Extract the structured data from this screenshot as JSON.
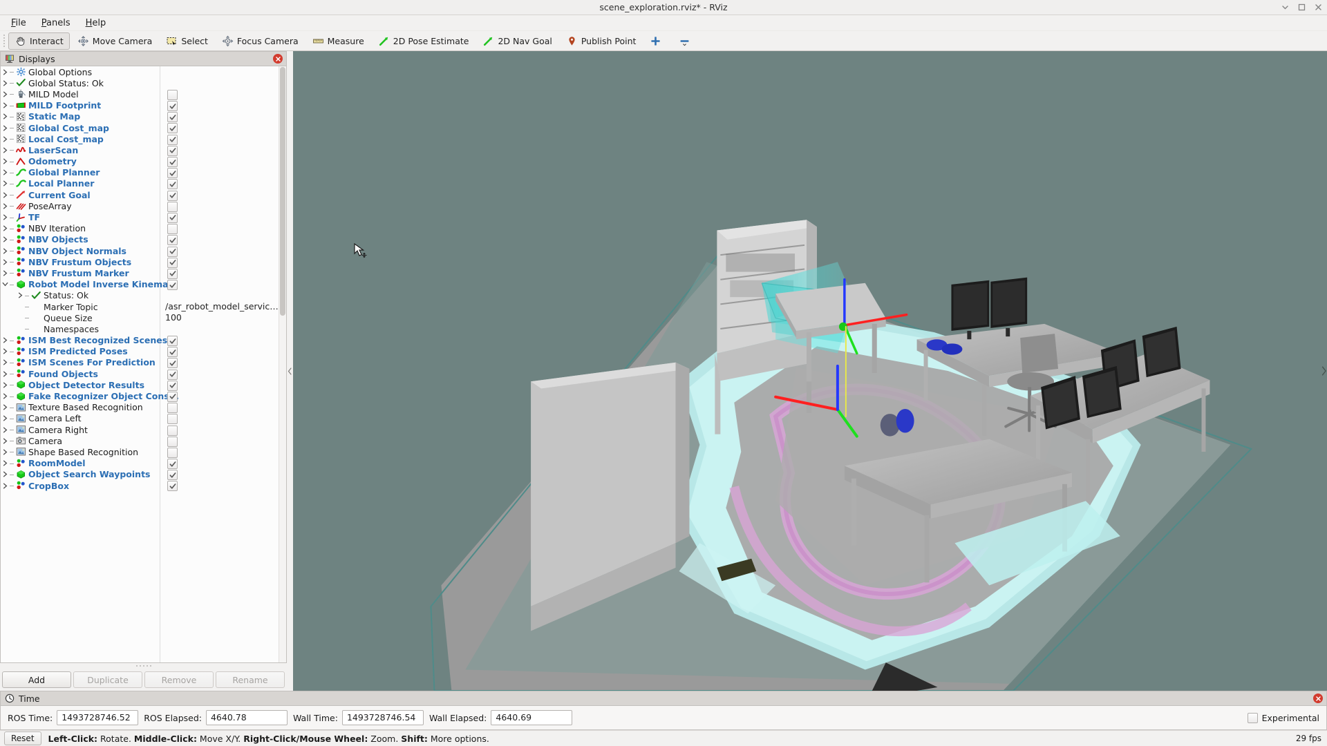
{
  "window": {
    "title": "scene_exploration.rviz* - RViz",
    "buttons": {
      "minimize": "minimize-button",
      "maximize": "maximize-button",
      "close": "close-button"
    }
  },
  "menubar": {
    "items": [
      {
        "label": "File",
        "mnemonic": "F"
      },
      {
        "label": "Panels",
        "mnemonic": "P"
      },
      {
        "label": "Help",
        "mnemonic": "H"
      }
    ]
  },
  "toolbar": {
    "items": [
      {
        "label": "Interact",
        "icon": "hand-icon",
        "active": true
      },
      {
        "label": "Move Camera",
        "icon": "move-camera-icon",
        "active": false
      },
      {
        "label": "Select",
        "icon": "select-rect-icon",
        "active": false
      },
      {
        "label": "Focus Camera",
        "icon": "focus-camera-icon",
        "active": false
      },
      {
        "label": "Measure",
        "icon": "ruler-icon",
        "active": false
      },
      {
        "label": "2D Pose Estimate",
        "icon": "green-arrow-icon",
        "active": false
      },
      {
        "label": "2D Nav Goal",
        "icon": "green-arrow-icon",
        "active": false
      },
      {
        "label": "Publish Point",
        "icon": "map-pin-icon",
        "active": false
      },
      {
        "label": "",
        "icon": "add-tool-icon",
        "active": false
      },
      {
        "label": "",
        "icon": "remove-tool-icon",
        "active": false
      }
    ]
  },
  "displays": {
    "title": "Displays",
    "close_label": "close-displays-panel",
    "tree": [
      {
        "label": "Global Options",
        "icon": "gear-icon",
        "depth": 0,
        "expandable": true,
        "enabled": null,
        "checked": null,
        "on": false
      },
      {
        "label": "Global Status: Ok",
        "icon": "check-icon",
        "depth": 0,
        "expandable": true,
        "enabled": null,
        "checked": null,
        "on": false
      },
      {
        "label": "MILD Model",
        "icon": "robot-icon",
        "depth": 0,
        "expandable": true,
        "checked": false,
        "on": false
      },
      {
        "label": "MILD Footprint",
        "icon": "polygon-icon",
        "depth": 0,
        "expandable": true,
        "checked": true,
        "on": true
      },
      {
        "label": "Static Map",
        "icon": "map-grid-icon",
        "depth": 0,
        "expandable": true,
        "checked": true,
        "on": true
      },
      {
        "label": "Global Cost_map",
        "icon": "map-grid-icon",
        "depth": 0,
        "expandable": true,
        "checked": true,
        "on": true
      },
      {
        "label": "Local Cost_map",
        "icon": "map-grid-icon",
        "depth": 0,
        "expandable": true,
        "checked": true,
        "on": true
      },
      {
        "label": "LaserScan",
        "icon": "laserscan-icon",
        "depth": 0,
        "expandable": true,
        "checked": true,
        "on": true
      },
      {
        "label": "Odometry",
        "icon": "odometry-icon",
        "depth": 0,
        "expandable": true,
        "checked": true,
        "on": true
      },
      {
        "label": "Global Planner",
        "icon": "path-icon",
        "depth": 0,
        "expandable": true,
        "checked": true,
        "on": true
      },
      {
        "label": "Local Planner",
        "icon": "path-icon",
        "depth": 0,
        "expandable": true,
        "checked": true,
        "on": true
      },
      {
        "label": "Current Goal",
        "icon": "pose-arrow-icon",
        "depth": 0,
        "expandable": true,
        "checked": true,
        "on": true
      },
      {
        "label": "PoseArray",
        "icon": "posearray-icon",
        "depth": 0,
        "expandable": true,
        "checked": false,
        "on": false
      },
      {
        "label": "TF",
        "icon": "tf-axes-icon",
        "depth": 0,
        "expandable": true,
        "checked": true,
        "on": true
      },
      {
        "label": "NBV Iteration",
        "icon": "markerarray-icon",
        "depth": 0,
        "expandable": true,
        "checked": false,
        "on": false
      },
      {
        "label": "NBV Objects",
        "icon": "markerarray-icon",
        "depth": 0,
        "expandable": true,
        "checked": true,
        "on": true
      },
      {
        "label": "NBV Object Normals",
        "icon": "markerarray-icon",
        "depth": 0,
        "expandable": true,
        "checked": true,
        "on": true
      },
      {
        "label": "NBV Frustum Objects",
        "icon": "markerarray-icon",
        "depth": 0,
        "expandable": true,
        "checked": true,
        "on": true
      },
      {
        "label": "NBV Frustum Marker",
        "icon": "markerarray-icon",
        "depth": 0,
        "expandable": true,
        "checked": true,
        "on": true
      },
      {
        "label": "Robot Model Inverse Kinema...",
        "icon": "marker-icon",
        "depth": 0,
        "expandable": true,
        "expanded": true,
        "checked": true,
        "on": true
      },
      {
        "label": "Status: Ok",
        "icon": "check-icon",
        "depth": 1,
        "expandable": true,
        "checked": null,
        "on": false,
        "sub": true
      },
      {
        "label": "Marker Topic",
        "icon": null,
        "depth": 1,
        "expandable": false,
        "value": "/asr_robot_model_service...",
        "sub": true
      },
      {
        "label": "Queue Size",
        "icon": null,
        "depth": 1,
        "expandable": false,
        "value": "100",
        "sub": true
      },
      {
        "label": "Namespaces",
        "icon": null,
        "depth": 1,
        "expandable": false,
        "value": "",
        "sub": true
      },
      {
        "label": "ISM Best Recognized Scenes",
        "icon": "markerarray-icon",
        "depth": 0,
        "expandable": true,
        "checked": true,
        "on": true
      },
      {
        "label": "ISM Predicted Poses",
        "icon": "markerarray-icon",
        "depth": 0,
        "expandable": true,
        "checked": true,
        "on": true
      },
      {
        "label": "ISM Scenes For Prediction",
        "icon": "markerarray-icon",
        "depth": 0,
        "expandable": true,
        "checked": true,
        "on": true
      },
      {
        "label": "Found Objects",
        "icon": "markerarray-icon",
        "depth": 0,
        "expandable": true,
        "checked": true,
        "on": true
      },
      {
        "label": "Object Detector Results",
        "icon": "marker-icon",
        "depth": 0,
        "expandable": true,
        "checked": true,
        "on": true
      },
      {
        "label": "Fake Recognizer Object Cons...",
        "icon": "marker-icon",
        "depth": 0,
        "expandable": true,
        "checked": true,
        "on": true
      },
      {
        "label": "Texture Based Recognition",
        "icon": "image-icon",
        "depth": 0,
        "expandable": true,
        "checked": false,
        "on": false
      },
      {
        "label": "Camera Left",
        "icon": "image-icon",
        "depth": 0,
        "expandable": true,
        "checked": false,
        "on": false
      },
      {
        "label": "Camera Right",
        "icon": "image-icon",
        "depth": 0,
        "expandable": true,
        "checked": false,
        "on": false
      },
      {
        "label": "Camera",
        "icon": "camera-icon",
        "depth": 0,
        "expandable": true,
        "checked": false,
        "on": false
      },
      {
        "label": "Shape Based Recognition",
        "icon": "image-icon",
        "depth": 0,
        "expandable": true,
        "checked": false,
        "on": false
      },
      {
        "label": "RoomModel",
        "icon": "markerarray-icon",
        "depth": 0,
        "expandable": true,
        "checked": true,
        "on": true
      },
      {
        "label": "Object Search Waypoints",
        "icon": "marker-icon",
        "depth": 0,
        "expandable": true,
        "checked": true,
        "on": true
      },
      {
        "label": "CropBox",
        "icon": "markerarray-icon",
        "depth": 0,
        "expandable": true,
        "checked": true,
        "on": true
      }
    ],
    "buttons": [
      {
        "label": "Add",
        "disabled": false
      },
      {
        "label": "Duplicate",
        "disabled": true
      },
      {
        "label": "Remove",
        "disabled": true
      },
      {
        "label": "Rename",
        "disabled": true
      }
    ]
  },
  "time_panel": {
    "title": "Time",
    "fields": [
      {
        "label": "ROS Time:",
        "value": "1493728746.52"
      },
      {
        "label": "ROS Elapsed:",
        "value": "4640.78"
      },
      {
        "label": "Wall Time:",
        "value": "1493728746.54"
      },
      {
        "label": "Wall Elapsed:",
        "value": "4640.69"
      }
    ],
    "experimental_label": "Experimental",
    "experimental_checked": false,
    "close_label": "close-time-panel"
  },
  "statusbar": {
    "reset_label": "Reset",
    "hint_parts": [
      {
        "text": "Left-Click:",
        "bold": true
      },
      {
        "text": " Rotate.  ",
        "bold": false
      },
      {
        "text": "Middle-Click:",
        "bold": true
      },
      {
        "text": " Move X/Y.  ",
        "bold": false
      },
      {
        "text": "Right-Click/Mouse Wheel:",
        "bold": true
      },
      {
        "text": " Zoom.  ",
        "bold": false
      },
      {
        "text": "Shift:",
        "bold": true
      },
      {
        "text": " More options.",
        "bold": false
      }
    ],
    "fps": "29 fps"
  },
  "colors": {
    "enabled_text": "#2c6fb4",
    "floor": "#6e8381",
    "costmap_cyan": "#a9eae8",
    "path_magenta": "#d9a8d8",
    "frustum_cyan": "#35d7d4",
    "axis_x": "#ff2b2b",
    "axis_y": "#22dd22",
    "axis_z": "#2b4bff",
    "furniture": "#b8b8b8",
    "monitor": "#1c1c1c",
    "accent_close": "#d23b2e"
  }
}
